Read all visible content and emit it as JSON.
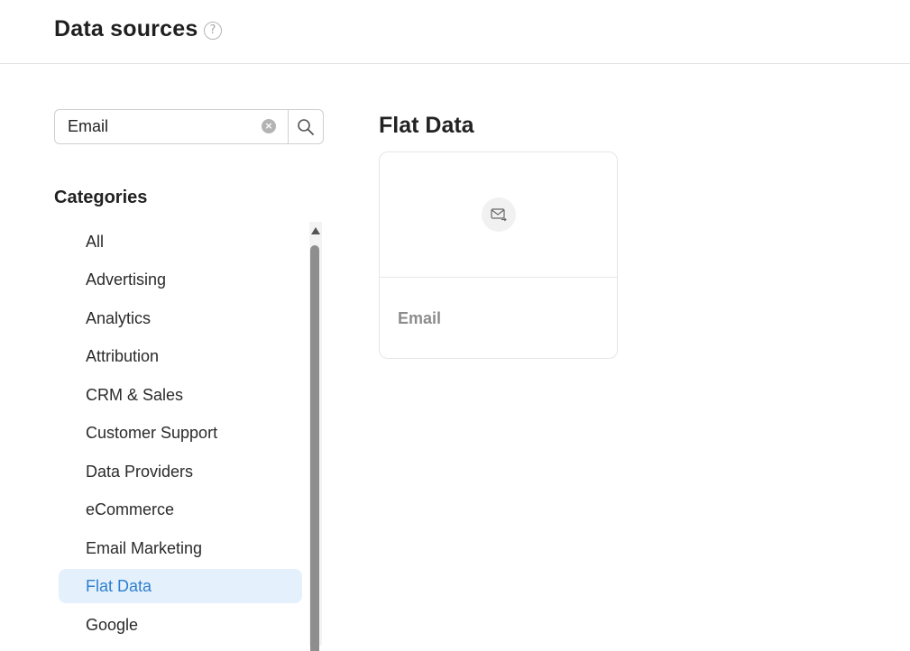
{
  "header": {
    "title": "Data sources",
    "help_glyph": "?"
  },
  "search": {
    "value": "Email",
    "placeholder": "",
    "clear_icon": "clear-icon",
    "search_icon": "search-icon"
  },
  "categories": {
    "title": "Categories",
    "items": [
      {
        "label": "All",
        "active": false
      },
      {
        "label": "Advertising",
        "active": false
      },
      {
        "label": "Analytics",
        "active": false
      },
      {
        "label": "Attribution",
        "active": false
      },
      {
        "label": "CRM & Sales",
        "active": false
      },
      {
        "label": "Customer Support",
        "active": false
      },
      {
        "label": "Data Providers",
        "active": false
      },
      {
        "label": "eCommerce",
        "active": false
      },
      {
        "label": "Email Marketing",
        "active": false
      },
      {
        "label": "Flat Data",
        "active": true
      },
      {
        "label": "Google",
        "active": false
      }
    ]
  },
  "main": {
    "section_title": "Flat Data",
    "cards": [
      {
        "label": "Email",
        "icon": "mail-icon"
      }
    ]
  },
  "colors": {
    "accent": "#2f7fd0",
    "active_bg": "#e4f1fc",
    "border": "#cfcfcf"
  }
}
